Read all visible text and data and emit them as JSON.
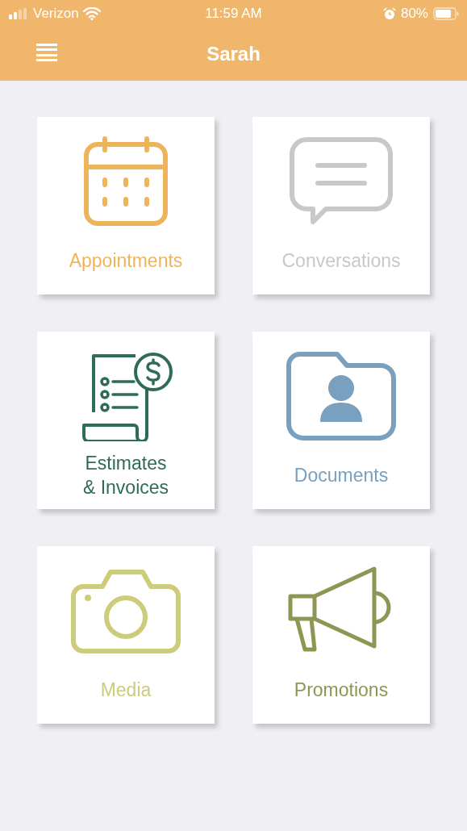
{
  "status_bar": {
    "carrier": "Verizon",
    "time": "11:59 AM",
    "battery": "80%"
  },
  "header": {
    "title": "Sarah"
  },
  "tiles": [
    {
      "kind": "calendar",
      "label": "Appointments",
      "color": "#eeb45c"
    },
    {
      "kind": "chat",
      "label": "Conversations",
      "color": "#c8c8c8"
    },
    {
      "kind": "invoice",
      "label": "Estimates\n& Invoices",
      "color": "#2e6b58"
    },
    {
      "kind": "folder",
      "label": "Documents",
      "color": "#7aa0bf"
    },
    {
      "kind": "camera",
      "label": "Media",
      "color": "#cdcc7a"
    },
    {
      "kind": "megaphone",
      "label": "Promotions",
      "color": "#8f9654"
    }
  ]
}
